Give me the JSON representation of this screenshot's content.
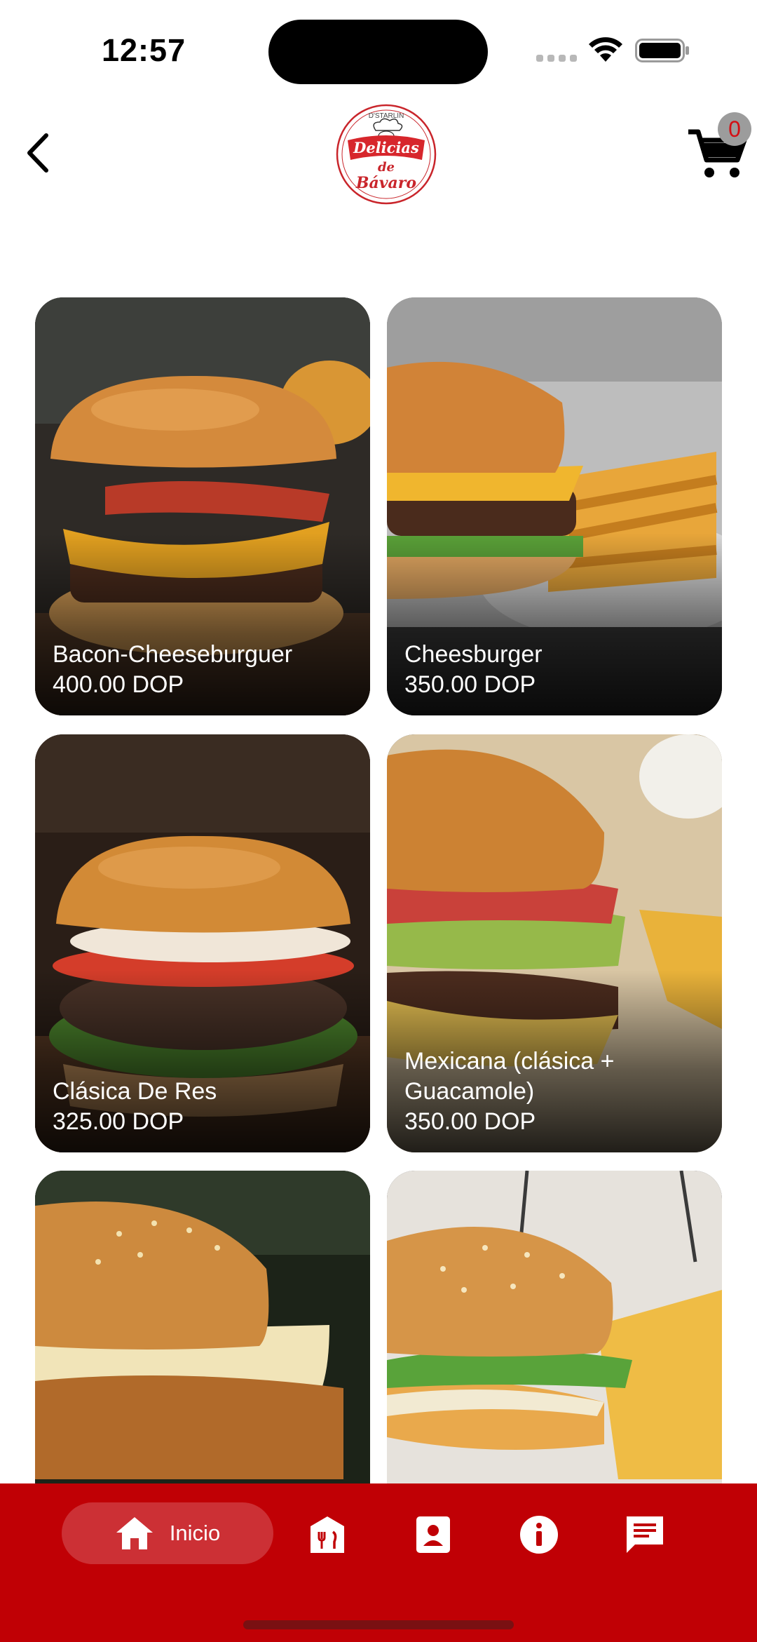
{
  "status_bar": {
    "time": "12:57"
  },
  "header": {
    "logo_text": {
      "top": "D'STARLIN",
      "line1": "Delicias",
      "line2": "de",
      "line3": "Bávaro"
    },
    "cart_count": "0"
  },
  "products": [
    {
      "name": "Bacon-Cheeseburguer",
      "price": "400.00 DOP"
    },
    {
      "name": "Cheesburger",
      "price": "350.00 DOP"
    },
    {
      "name": "Clásica De Res",
      "price": "325.00 DOP"
    },
    {
      "name_line1": "Mexicana (clásica +",
      "name_line2": "Guacamole)",
      "price": "350.00 DOP"
    }
  ],
  "bottom_nav": {
    "home_label": "Inicio",
    "items": [
      "home-icon",
      "restaurant-menu-icon",
      "contact-icon",
      "info-icon",
      "chat-icon"
    ]
  },
  "colors": {
    "brand_red": "#c00005",
    "active_pill": "#cc3035",
    "badge_gray": "#9c9c9c"
  }
}
